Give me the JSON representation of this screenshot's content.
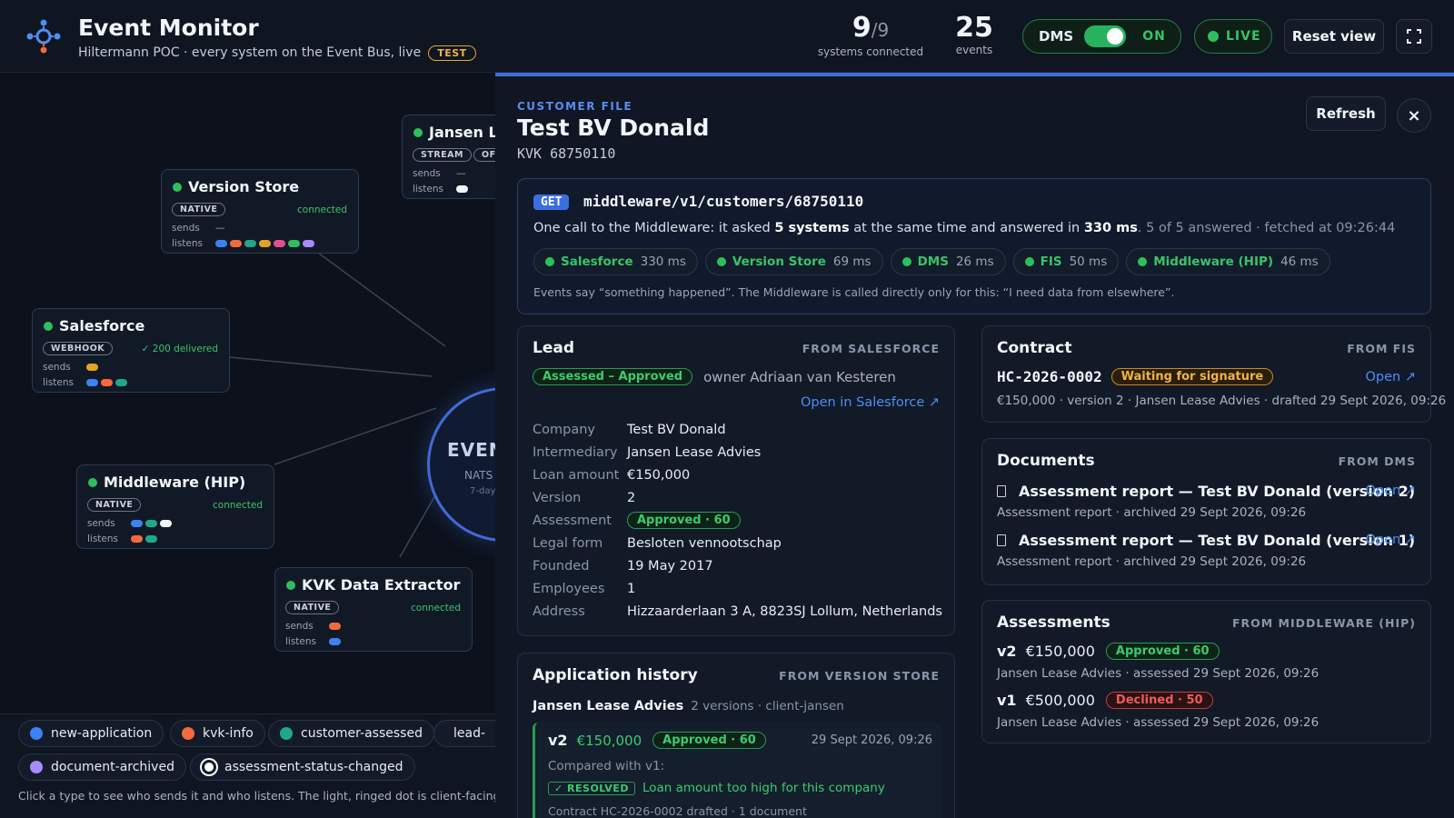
{
  "header": {
    "title": "Event Monitor",
    "subtitle": "Hiltermann POC · every system on the Event Bus, live",
    "env_badge": "TEST",
    "systems_connected": "9",
    "systems_total": "/9",
    "systems_label": "systems connected",
    "events_count": "25",
    "events_label": "events",
    "dms_label": "DMS",
    "dms_state": "ON",
    "live_label": "LIVE",
    "reset_label": "Reset view"
  },
  "graph": {
    "hub": {
      "title": "EVEN",
      "line1": "NATS .",
      "line2": "7-day"
    },
    "nodes": {
      "jansen": {
        "title": "Jansen Le",
        "badge": "STREAM",
        "badge2": "OFF",
        "sends_label": "sends",
        "listens_label": "listens",
        "sends_value": "—"
      },
      "version_store": {
        "title": "Version Store",
        "badge": "NATIVE",
        "status": "connected",
        "sends_label": "sends",
        "listens_label": "listens",
        "sends_value": "—"
      },
      "salesforce": {
        "title": "Salesforce",
        "badge": "WEBHOOK",
        "status": "✓ 200 delivered",
        "sends_label": "sends",
        "listens_label": "listens"
      },
      "middleware": {
        "title": "Middleware (HIP)",
        "badge": "NATIVE",
        "status": "connected",
        "sends_label": "sends",
        "listens_label": "listens"
      },
      "kvk": {
        "title": "KVK Data Extractor",
        "badge": "NATIVE",
        "status": "connected",
        "sends_label": "sends",
        "listens_label": "listens"
      }
    },
    "event_colors": {
      "blue": "#3b82f6",
      "orange": "#f26a3d",
      "teal": "#1fa88a",
      "amber": "#e0a325",
      "pink": "#e0508f",
      "green": "#2ebf5c",
      "violet": "#a78bfa",
      "white": "#f2f6fc"
    },
    "legend": [
      {
        "label": "new-application",
        "color": "#3b82f6"
      },
      {
        "label": "kvk-info",
        "color": "#f26a3d"
      },
      {
        "label": "customer-assessed",
        "color": "#1fa88a"
      },
      {
        "label": "lead-",
        "color": "#e0a325"
      },
      {
        "label": "document-archived",
        "color": "#a78bfa"
      },
      {
        "label": "assessment-status-changed",
        "color": "#ffffff"
      }
    ],
    "legend_hint": "Click a type to see who sends it and who listens. The light, ringed dot is client-facing"
  },
  "panel": {
    "eyebrow": "CUSTOMER FILE",
    "title": "Test BV Donald",
    "kvk": "KVK 68750110",
    "refresh_label": "Refresh",
    "close_label": "×",
    "middleware": {
      "method": "GET",
      "path": "middleware/v1/customers/68750110",
      "desc_a": "One call to the Middleware: it asked ",
      "desc_b": "5 systems",
      "desc_c": " at the same time and answered in ",
      "desc_d": "330 ms",
      "desc_e": ". 5 of 5 answered · fetched at 09:26:44",
      "systems": [
        {
          "name": "Salesforce",
          "ms": "330 ms"
        },
        {
          "name": "Version Store",
          "ms": "69 ms"
        },
        {
          "name": "DMS",
          "ms": "26 ms"
        },
        {
          "name": "FIS",
          "ms": "50 ms"
        },
        {
          "name": "Middleware (HIP)",
          "ms": "46 ms"
        }
      ],
      "note": "Events say “something happened”. The Middleware is called directly only for this: “I need data from elsewhere”."
    },
    "lead": {
      "title": "Lead",
      "from": "FROM SALESFORCE",
      "status": "Assessed – Approved",
      "owner": "owner Adriaan van Kesteren",
      "open_link": "Open in Salesforce ↗",
      "fields": [
        {
          "k": "Company",
          "v": "Test BV Donald"
        },
        {
          "k": "Intermediary",
          "v": "Jansen Lease Advies"
        },
        {
          "k": "Loan amount",
          "v": "€150,000"
        },
        {
          "k": "Version",
          "v": "2"
        },
        {
          "k": "Assessment",
          "v": "Approved · 60"
        },
        {
          "k": "Legal form",
          "v": "Besloten vennootschap"
        },
        {
          "k": "Founded",
          "v": "19 May 2017"
        },
        {
          "k": "Employees",
          "v": "1"
        },
        {
          "k": "Address",
          "v": "Hizzaarderlaan 3 A, 8823SJ Lollum, Netherlands"
        }
      ]
    },
    "history": {
      "title": "Application history",
      "from": "FROM VERSION STORE",
      "intermediary": "Jansen Lease Advies",
      "meta": "2 versions · client-jansen",
      "version": "v2",
      "amount": "€150,000",
      "assessment": "Approved · 60",
      "date": "29 Sept 2026, 09:26",
      "compared": "Compared with v1:",
      "resolved_badge": "✓ RESOLVED",
      "resolved_text": "Loan amount too high for this company",
      "more": "Contract HC-2026-0002 drafted · 1 document"
    },
    "contract": {
      "title": "Contract",
      "from": "FROM FIS",
      "id": "HC-2026-0002",
      "status": "Waiting for signature",
      "open_link": "Open ↗",
      "details": "€150,000 · version 2 · Jansen Lease Advies · drafted 29 Sept 2026, 09:26"
    },
    "documents": {
      "title": "Documents",
      "from": "FROM DMS",
      "items": [
        {
          "title": "Assessment report — Test BV Donald (version 2)",
          "sub": "Assessment report · archived 29 Sept 2026, 09:26",
          "open": "Open ↗"
        },
        {
          "title": "Assessment report — Test BV Donald (version 1)",
          "sub": "Assessment report · archived 29 Sept 2026, 09:26",
          "open": "Open ↗"
        }
      ]
    },
    "assessments": {
      "title": "Assessments",
      "from": "FROM MIDDLEWARE (HIP)",
      "items": [
        {
          "version": "v2",
          "amount": "€150,000",
          "result": "Approved · 60",
          "sub": "Jansen Lease Advies · assessed 29 Sept 2026, 09:26"
        },
        {
          "version": "v1",
          "amount": "€500,000",
          "result": "Declined · 50",
          "sub": "Jansen Lease Advies · assessed 29 Sept 2026, 09:26"
        }
      ]
    }
  }
}
